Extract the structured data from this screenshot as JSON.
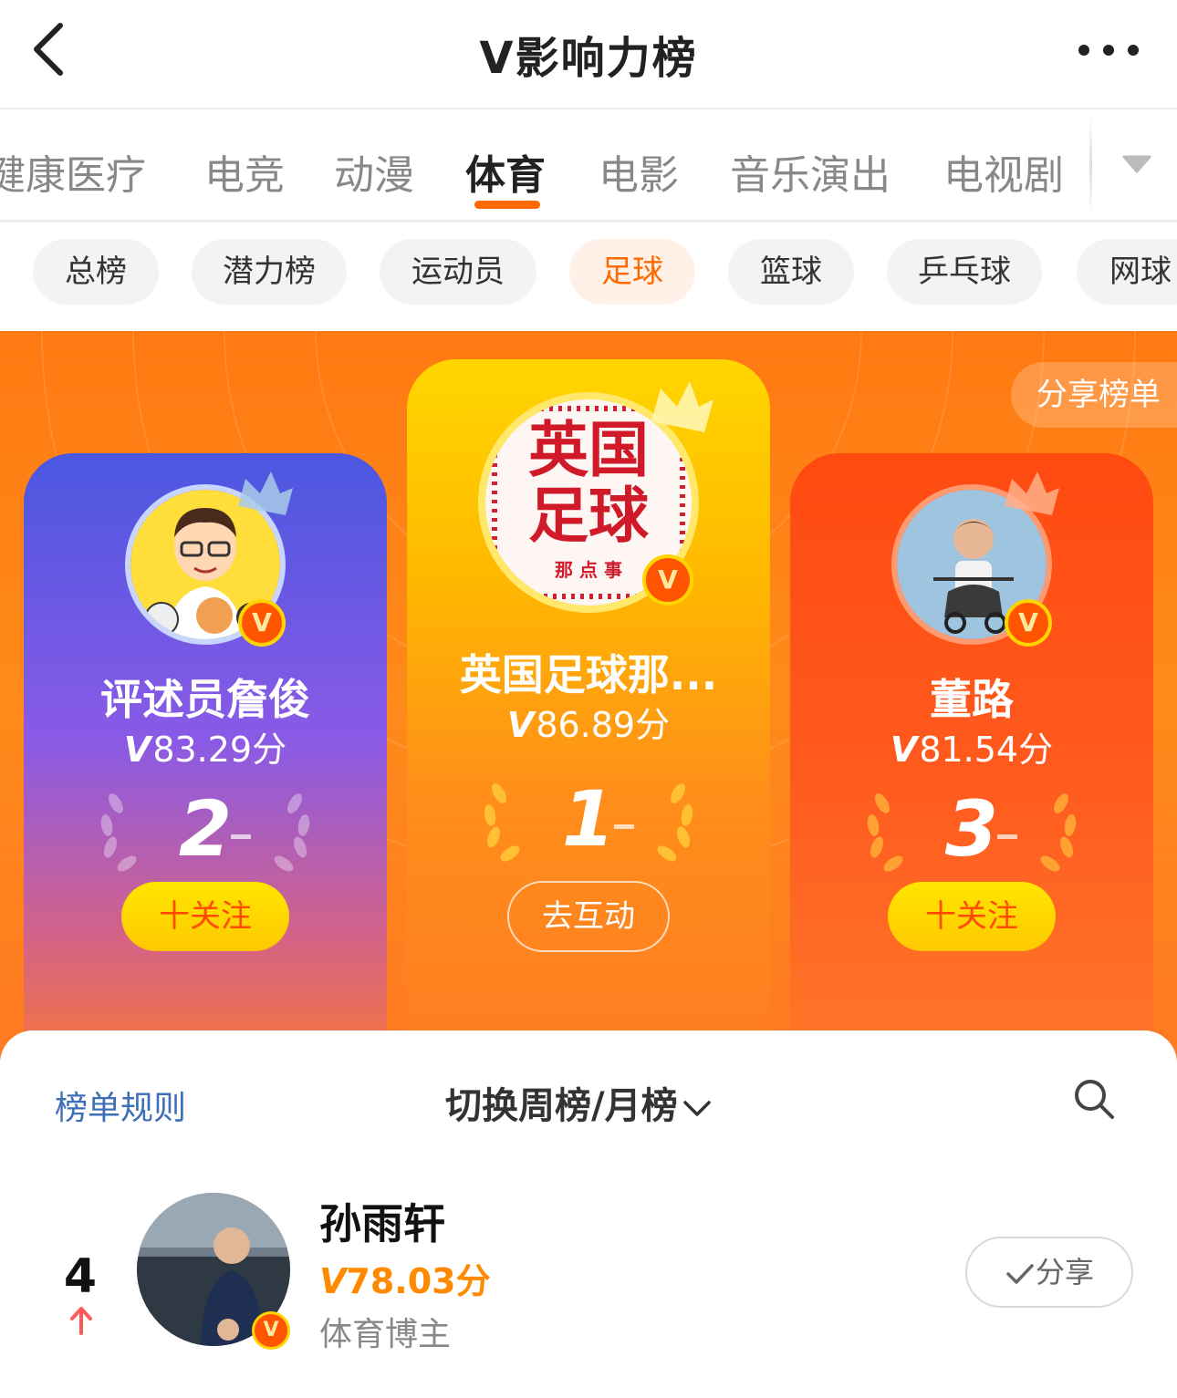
{
  "header": {
    "title": "V影响力榜"
  },
  "categories": [
    {
      "label": "健康医疗"
    },
    {
      "label": "电竞"
    },
    {
      "label": "动漫"
    },
    {
      "label": "体育"
    },
    {
      "label": "电影"
    },
    {
      "label": "音乐演出"
    },
    {
      "label": "电视剧"
    }
  ],
  "active_category": "体育",
  "chips": [
    {
      "label": "总榜"
    },
    {
      "label": "潜力榜"
    },
    {
      "label": "运动员"
    },
    {
      "label": "足球"
    },
    {
      "label": "篮球"
    },
    {
      "label": "乒乓球"
    },
    {
      "label": "网球"
    }
  ],
  "active_chip": "足球",
  "banner": {
    "share_label": "分享榜单"
  },
  "podium": {
    "first": {
      "name": "英国足球那...",
      "v": "V",
      "score": "86.89分",
      "rank": "1",
      "button": "去互动",
      "avatar_text_top": "英国",
      "avatar_text_mid": "足球",
      "avatar_text_bottom": "那 点 事"
    },
    "second": {
      "name": "评述员詹俊",
      "v": "V",
      "score": "83.29分",
      "rank": "2",
      "button": "十关注"
    },
    "third": {
      "name": "董路",
      "v": "V",
      "score": "81.54分",
      "rank": "3",
      "button": "十关注"
    }
  },
  "verified_badge": "V",
  "list": {
    "rules_label": "榜单规则",
    "switch_label": "切换周榜/月榜",
    "rows": [
      {
        "rank": "4",
        "trend": "up",
        "name": "孙雨轩",
        "v": "V",
        "score": "78.03分",
        "desc": "体育博主",
        "share_label": "分享"
      }
    ]
  },
  "colors": {
    "accent": "#ff6a00",
    "link": "#3c6fb5",
    "score": "#ff8a00"
  }
}
